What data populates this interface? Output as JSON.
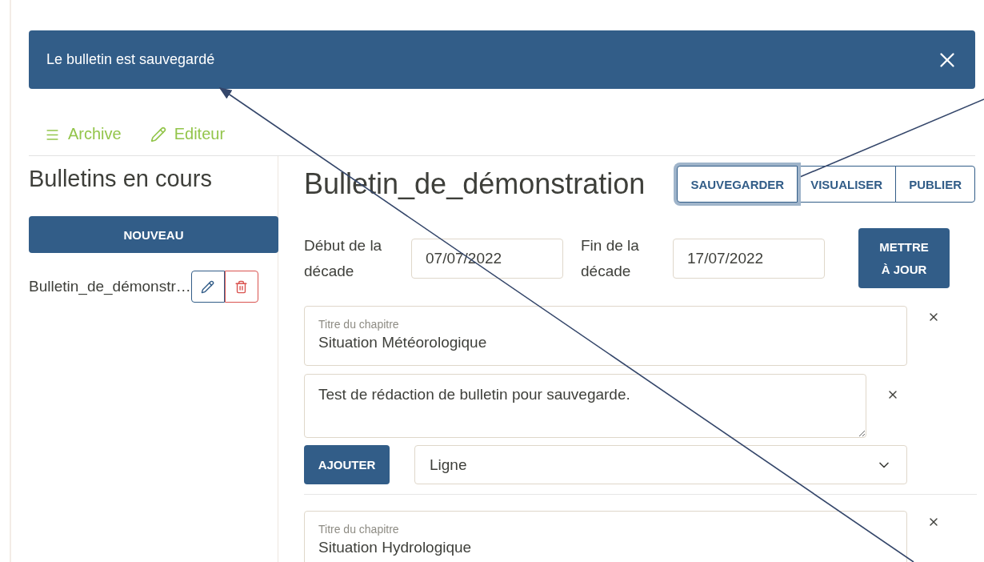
{
  "toast": {
    "message": "Le bulletin est sauvegardé"
  },
  "nav": [
    {
      "label": "Archive",
      "kind": "list"
    },
    {
      "label": "Editeur",
      "kind": "edit"
    }
  ],
  "sidebar": {
    "title": "Bulletins en cours",
    "new_button": "NOUVEAU",
    "bulletins": [
      {
        "name": "Bulletin_de_démonstr…"
      }
    ]
  },
  "editor": {
    "title": "Bulletin_de_démonstration",
    "actions": [
      {
        "label": "SAUVEGARDER",
        "focused": true
      },
      {
        "label": "VISUALISER",
        "focused": false
      },
      {
        "label": "PUBLIER",
        "focused": false
      }
    ],
    "period": {
      "start_label": "Début de la décade",
      "start_value": "07/07/2022",
      "end_label": "Fin de la décade",
      "end_value": "17/07/2022",
      "update_button": "METTRE À JOUR"
    },
    "chapters": [
      {
        "title_label": "Titre du chapitre",
        "title": "Situation Météorologique",
        "blocks": [
          {
            "text": "Test de rédaction de bulletin pour sauvegarde."
          }
        ],
        "add_button": "AJOUTER",
        "block_type": "Ligne"
      },
      {
        "title_label": "Titre du chapitre",
        "title": "Situation Hydrologique"
      }
    ]
  }
}
